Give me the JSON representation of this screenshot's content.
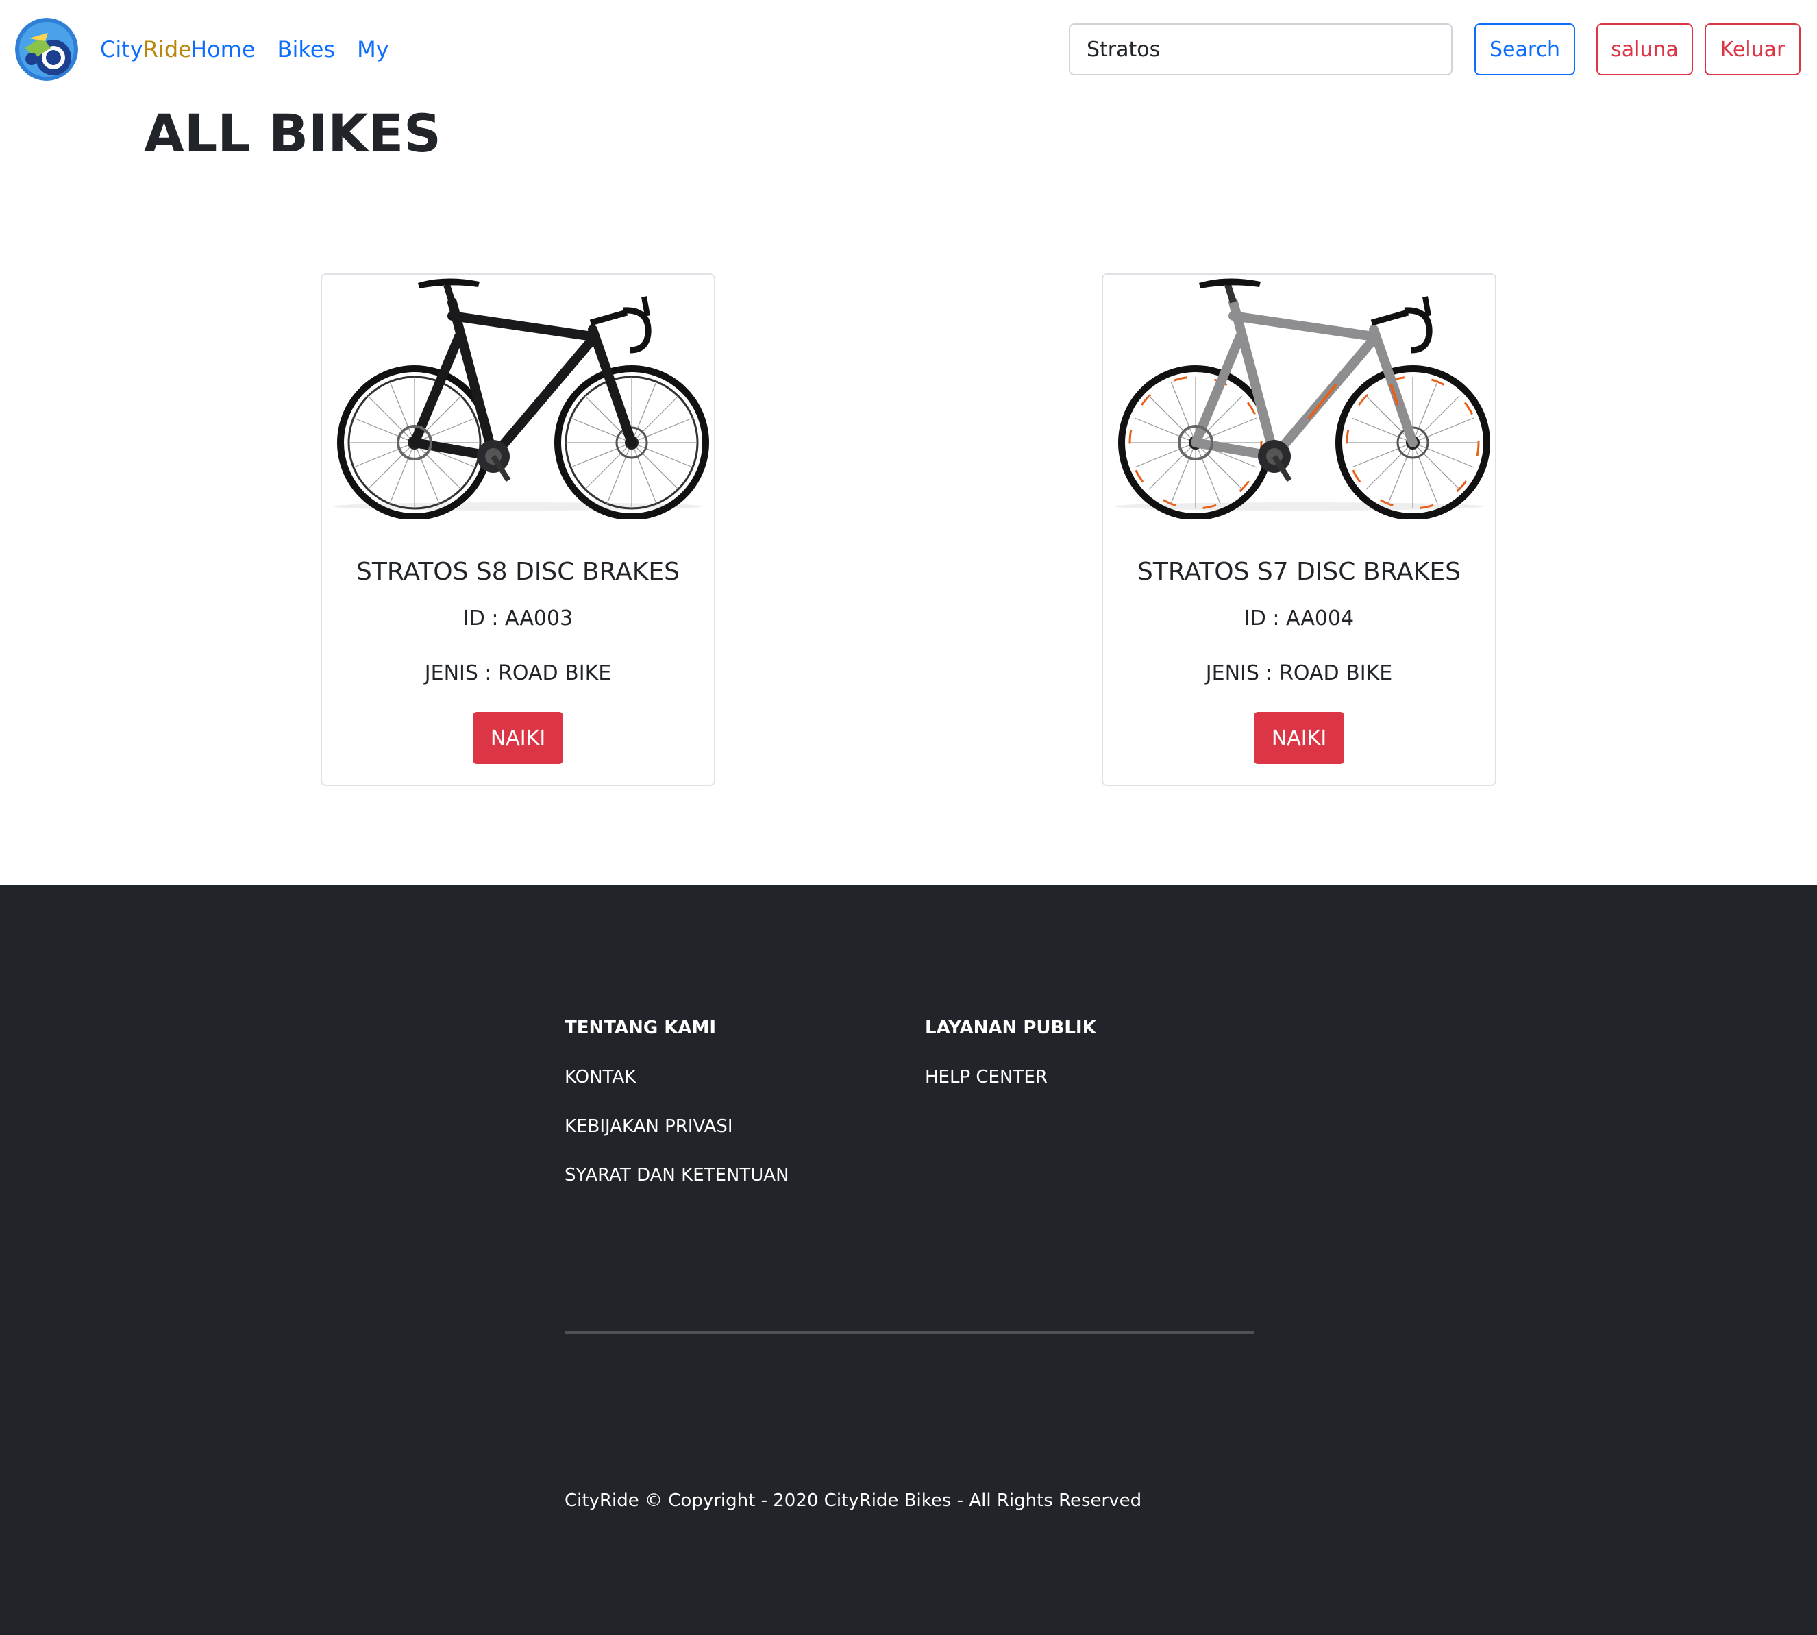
{
  "nav": {
    "brand_city": "City",
    "brand_ride": "Ride",
    "links": [
      {
        "label": "Home"
      },
      {
        "label": "Bikes"
      },
      {
        "label": "My"
      }
    ],
    "search_value": "Stratos",
    "search_button": "Search",
    "user_button": "saluna",
    "logout_button": "Keluar"
  },
  "page": {
    "title": "ALL BIKES"
  },
  "bikes": [
    {
      "name": "STRATOS S8 DISC BRAKES",
      "id_text": "ID : AA003",
      "type_text": "JENIS : ROAD BIKE",
      "button": "NAIKI",
      "frame_color": "#1a1a1d",
      "accent_color": "#2a2a2e"
    },
    {
      "name": "STRATOS S7 DISC BRAKES",
      "id_text": "ID : AA004",
      "type_text": "JENIS : ROAD BIKE",
      "button": "NAIKI",
      "frame_color": "#8e8e90",
      "accent_color": "#e8611a"
    }
  ],
  "footer": {
    "col1_heading": "TENTANG KAMI",
    "col1_links": [
      "KONTAK",
      "KEBIJAKAN PRIVASI",
      "SYARAT DAN KETENTUAN"
    ],
    "col2_heading": "LAYANAN PUBLIK",
    "col2_links": [
      "HELP CENTER"
    ],
    "copyright": "CityRide © Copyright - 2020 CityRide Bikes - All Rights Reserved"
  }
}
